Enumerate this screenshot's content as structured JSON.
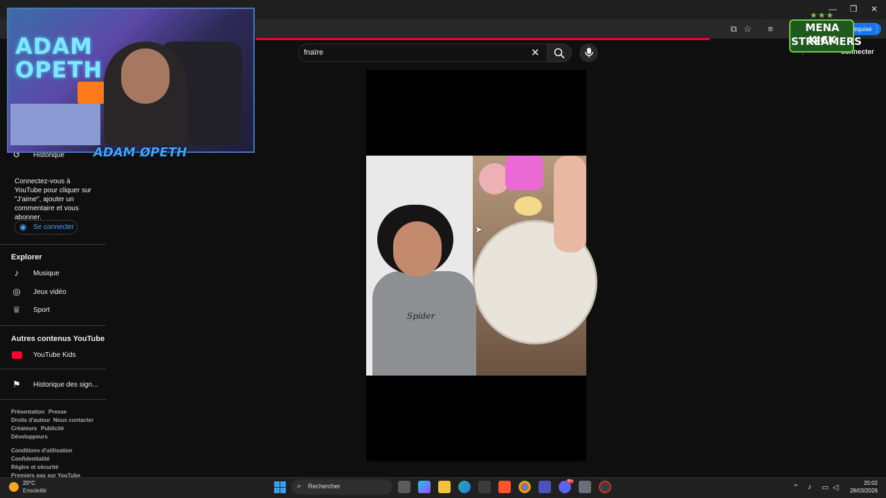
{
  "browser": {
    "profile_label": "equise"
  },
  "overlay": {
    "webcam_title_line1": "ADAM",
    "webcam_title_line2": "OPETH",
    "streamer_tag": "ADAM ØPETH",
    "badge_line1": "MENA KICK",
    "badge_line2": "STREAMERS"
  },
  "youtube": {
    "search_value": "fnaïre",
    "signin_top_label": "connecter",
    "sidebar": {
      "history_label": "Historique",
      "signin_prompt": "Connectez-vous à YouTube pour cliquer sur \"J'aime\", ajouter un commentaire et vous abonner.",
      "signin_button": "Se connecter",
      "explore_heading": "Explorer",
      "explore_items": [
        "Musique",
        "Jeux vidéo",
        "Sport"
      ],
      "other_heading": "Autres contenus YouTube",
      "other_items": [
        "YouTube Kids"
      ],
      "report_history": "Historique des sign...",
      "footer_row1": [
        "Présentation",
        "Presse"
      ],
      "footer_row2": [
        "Droits d'auteur",
        "Nous contacter"
      ],
      "footer_row3": [
        "Créateurs",
        "Publicité"
      ],
      "footer_row4": [
        "Développeurs"
      ],
      "footer_row5": [
        "Conditions d'utilisation"
      ],
      "footer_row6": [
        "Confidentialité"
      ],
      "footer_row7": [
        "Règles et sécurité"
      ],
      "footer_row8": [
        "Premiers pas sur YouTube"
      ]
    },
    "video": {
      "shirt_text": "Spider"
    }
  },
  "taskbar": {
    "weather_temp": "20°C",
    "weather_desc": "Ensoleillé",
    "search_label": "Rechercher",
    "time": "20:02",
    "date": "28/03/2026",
    "discord_badge": "9+"
  }
}
